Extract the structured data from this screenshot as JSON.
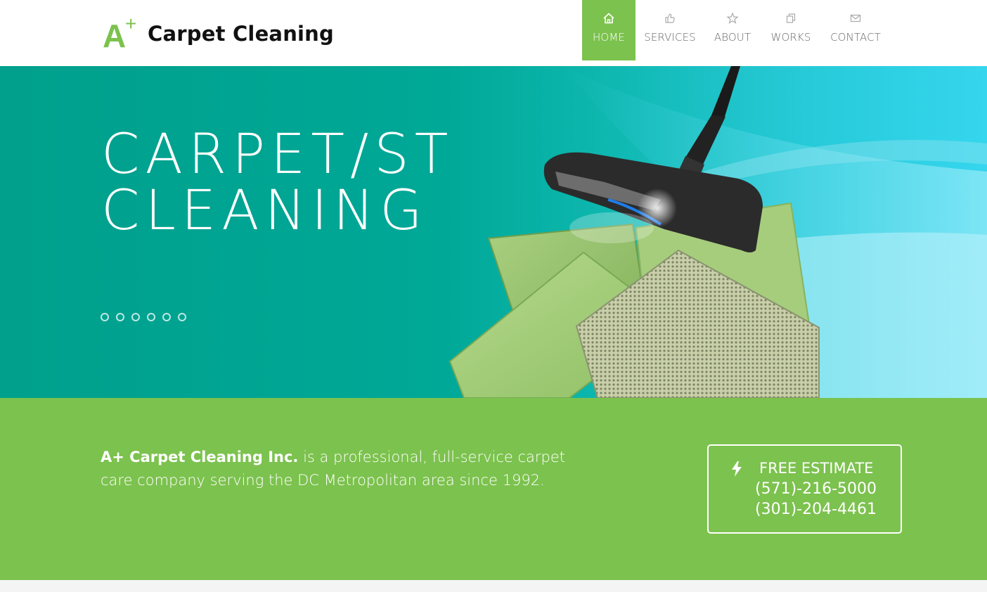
{
  "brand": {
    "logo_letter": "A",
    "logo_plus": "+",
    "name": "Carpet Cleaning",
    "accent": "#7cc24e"
  },
  "nav": [
    {
      "label": "HOME",
      "icon": "home-icon",
      "active": true
    },
    {
      "label": "SERVICES",
      "icon": "thumbs-up-icon",
      "active": false
    },
    {
      "label": "ABOUT",
      "icon": "star-icon",
      "active": false
    },
    {
      "label": "WORKS",
      "icon": "copy-icon",
      "active": false
    },
    {
      "label": "CONTACT",
      "icon": "envelope-icon",
      "active": false
    }
  ],
  "hero": {
    "title_line1": "CARPET/ST",
    "title_line2": "CLEANING",
    "slide_count": 6,
    "image": "vacuum-cleaning-carpet-samples"
  },
  "intro": {
    "company": "A+ Carpet Cleaning Inc.",
    "text": " is a professional, full-service carpet care company serving the DC Metropolitan area since 1992."
  },
  "estimate": {
    "icon": "bolt-icon",
    "label": "FREE ESTIMATE",
    "phone1": "(571)-216-5000",
    "phone2": "(301)-204-4461"
  }
}
